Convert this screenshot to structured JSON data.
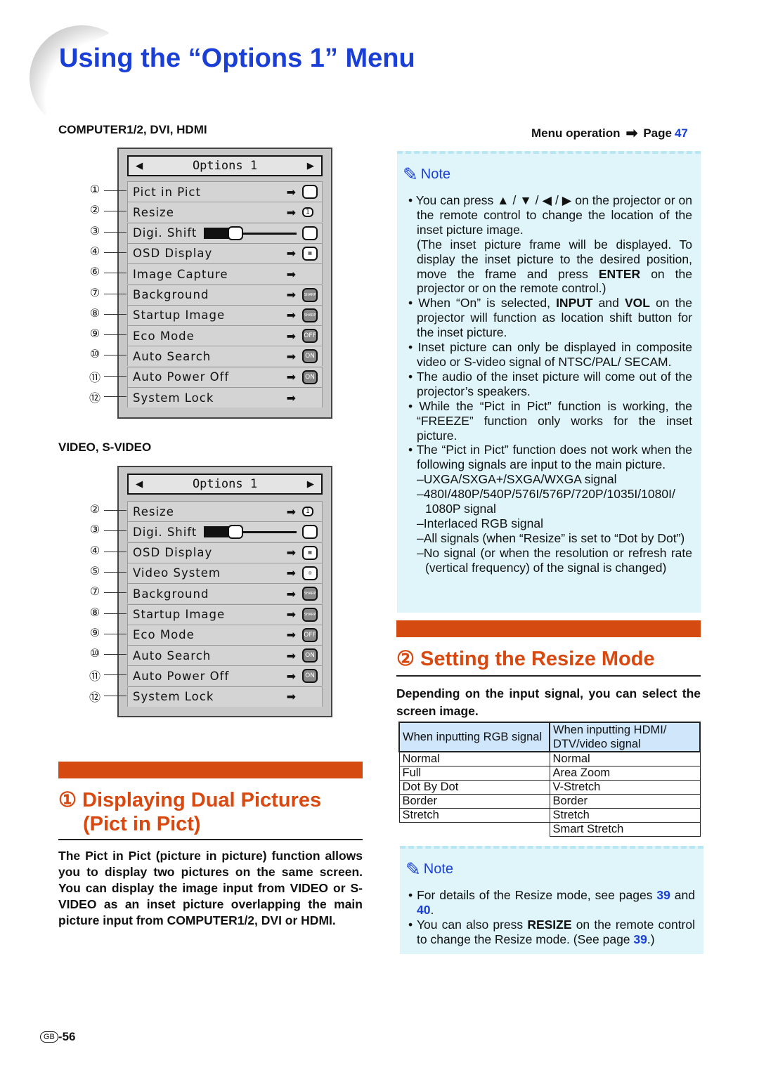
{
  "header": {
    "title": "Using the “Options 1” Menu"
  },
  "menu_operation": {
    "label": "Menu operation",
    "page_label": "Page",
    "page": "47"
  },
  "menu1": {
    "label": "COMPUTER1/2, DVI, HDMI",
    "title": "Options 1",
    "rows": [
      {
        "num": "①",
        "label": "Pict in Pict",
        "icon": ""
      },
      {
        "num": "②",
        "label": "Resize",
        "icon": "1"
      },
      {
        "num": "③",
        "label": "Digi. Shift",
        "icon": "slider"
      },
      {
        "num": "④",
        "label": "OSD Display",
        "icon": "▦"
      },
      {
        "num": "⑥",
        "label": "Image Capture",
        "icon": "none"
      },
      {
        "num": "⑦",
        "label": "Background",
        "icon": "SHARP"
      },
      {
        "num": "⑧",
        "label": "Startup Image",
        "icon": "SHARP"
      },
      {
        "num": "⑨",
        "label": "Eco Mode",
        "icon": "OFF"
      },
      {
        "num": "⑩",
        "label": "Auto Search",
        "icon": "ON"
      },
      {
        "num": "⑪",
        "label": "Auto Power Off",
        "icon": "ON"
      },
      {
        "num": "⑫",
        "label": "System Lock",
        "icon": "none"
      }
    ]
  },
  "menu2": {
    "label": "VIDEO, S-VIDEO",
    "title": "Options 1",
    "rows": [
      {
        "num": "②",
        "label": "Resize",
        "icon": "1"
      },
      {
        "num": "③",
        "label": "Digi. Shift",
        "icon": "slider"
      },
      {
        "num": "④",
        "label": "OSD Display",
        "icon": "▦"
      },
      {
        "num": "⑤",
        "label": "Video System",
        "icon": "◎"
      },
      {
        "num": "⑦",
        "label": "Background",
        "icon": "SHARP"
      },
      {
        "num": "⑧",
        "label": "Startup Image",
        "icon": "SHARP"
      },
      {
        "num": "⑨",
        "label": "Eco Mode",
        "icon": "OFF"
      },
      {
        "num": "⑩",
        "label": "Auto Search",
        "icon": "ON"
      },
      {
        "num": "⑪",
        "label": "Auto Power Off",
        "icon": "ON"
      },
      {
        "num": "⑫",
        "label": "System Lock",
        "icon": "none"
      }
    ]
  },
  "note1": {
    "heading": "Note"
  },
  "note2": {
    "heading": "Note"
  },
  "section1": {
    "title_line1": "① Displaying Dual Pictures",
    "title_line2": "(Pict in Pict)",
    "body": "The Pict in Pict (picture in picture) function allows you to display two pictures on the same screen. You can display the image input from VIDEO or S-VIDEO as an inset picture overlapping the main picture input from COMPUTER1/2, DVI or HDMI."
  },
  "section2": {
    "title": "② Setting the Resize Mode",
    "body": "Depending on the input signal, you can select the screen image."
  },
  "resize_table": {
    "headers": [
      "When inputting RGB signal",
      "When inputting HDMI/ DTV/video signal"
    ],
    "rgb": [
      "Normal",
      "Full",
      "Dot By Dot",
      "Border",
      "Stretch"
    ],
    "hdmi": [
      "Normal",
      "Area Zoom",
      "V-Stretch",
      "Border",
      "Stretch",
      "Smart Stretch"
    ]
  },
  "footer": {
    "region": "GB",
    "page": "-56"
  }
}
